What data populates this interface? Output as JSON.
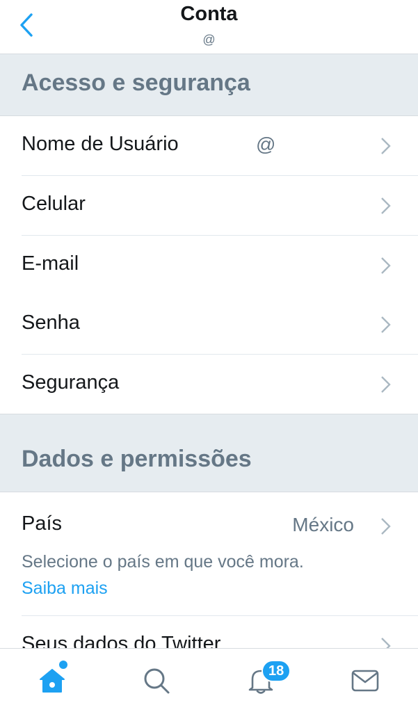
{
  "header": {
    "title": "Conta",
    "subtitle": "@"
  },
  "sections": {
    "access": "Acesso e segurança",
    "data": "Dados e permissões"
  },
  "rows": {
    "username": {
      "label": "Nome de Usuário",
      "value": "@"
    },
    "phone": {
      "label": "Celular"
    },
    "email": {
      "label": "E-mail"
    },
    "password": {
      "label": "Senha"
    },
    "security": {
      "label": "Segurança"
    }
  },
  "country": {
    "label": "País",
    "value": "México",
    "description": "Selecione o país em que você mora.",
    "link": "Saiba mais"
  },
  "partial_row": {
    "label": "Seus dados do Twitter"
  },
  "tabbar": {
    "notifications_badge": "18",
    "icons": [
      "home-icon",
      "search-icon",
      "bell-icon",
      "mail-icon"
    ]
  },
  "colors": {
    "accent": "#1da1f2",
    "section_bg": "#e6ecf0",
    "muted_text": "#657786"
  }
}
